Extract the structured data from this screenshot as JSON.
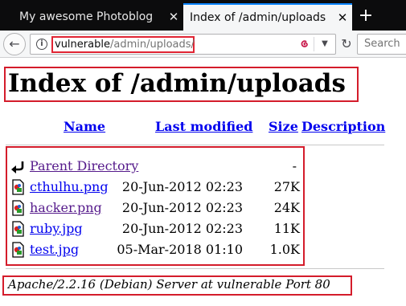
{
  "tabs": [
    {
      "title": "My awesome Photoblog",
      "close": "✕"
    },
    {
      "title": "Index of /admin/uploads",
      "close": "✕"
    }
  ],
  "new_tab_label": "+",
  "navbar": {
    "url_host": "vulnerable",
    "url_path": "/admin/uploads/",
    "search_placeholder": "Search",
    "back_glyph": "←",
    "reload_glyph": "↻",
    "info_glyph": "i",
    "dropdown_glyph": "▼"
  },
  "page": {
    "title": "Index of /admin/uploads",
    "columns": {
      "name": "Name",
      "last_modified": "Last modified",
      "size": "Size",
      "description": "Description"
    },
    "parent": {
      "label": "Parent Directory",
      "size": "-"
    },
    "files": [
      {
        "name": "cthulhu.png",
        "modified": "20-Jun-2012 02:23",
        "size": "27K",
        "visited": false
      },
      {
        "name": "hacker.png",
        "modified": "20-Jun-2012 02:23",
        "size": "24K",
        "visited": true
      },
      {
        "name": "ruby.jpg",
        "modified": "20-Jun-2012 02:23",
        "size": "11K",
        "visited": false
      },
      {
        "name": "test.jpg",
        "modified": "05-Mar-2018 01:10",
        "size": "1.0K",
        "visited": false
      }
    ],
    "footer": "Apache/2.2.16 (Debian) Server at vulnerable Port 80"
  },
  "colors": {
    "highlight": "#d41c2b",
    "link": "#0000ee",
    "visited": "#551a8b",
    "tab_accent": "#0a84ff"
  }
}
